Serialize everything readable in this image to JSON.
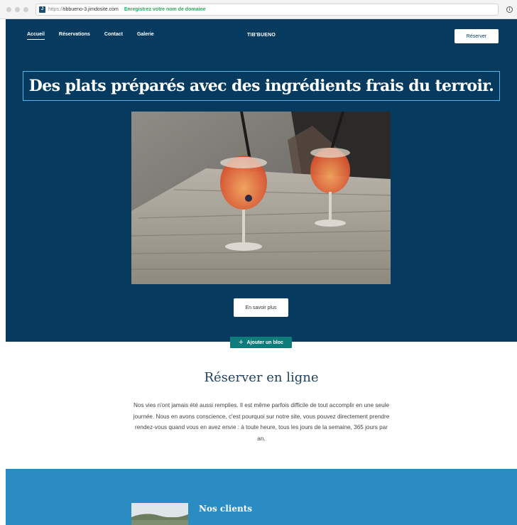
{
  "browser": {
    "url_protocol": "https://",
    "url_host": "tibbueno-3.jimdosite.com",
    "promo": "Enregistrez votre nom de domaine",
    "favicon_letter": "J"
  },
  "nav": {
    "items": [
      "Accueil",
      "Réservations",
      "Contact",
      "Galerie"
    ],
    "active": "Accueil",
    "brand": "TIB'BUENO",
    "reserve_button": "Réserver"
  },
  "hero": {
    "headline": "Des plats préparés avec des ingrédients frais du terroir.",
    "more_button": "En savoir plus"
  },
  "editor": {
    "add_block": "Ajouter un bloc"
  },
  "booking": {
    "title": "Réserver en ligne",
    "text": "Nos vies n'ont jamais été aussi remplies. Il est même parfois difficile de tout accomplir en une seule journée. Nous en avons conscience, c'est pourquoi sur notre site, vous pouvez directement prendre rendez-vous quand vous en avez envie : à toute heure, tous les jours de la semaine, 365 jours par an."
  },
  "clients": {
    "title": "Nos clients"
  },
  "colors": {
    "hero_bg": "#063a5f",
    "accent_border": "#56b4e9",
    "add_block_bg": "#0e7c7b",
    "clients_bg": "#2b8cc4"
  }
}
